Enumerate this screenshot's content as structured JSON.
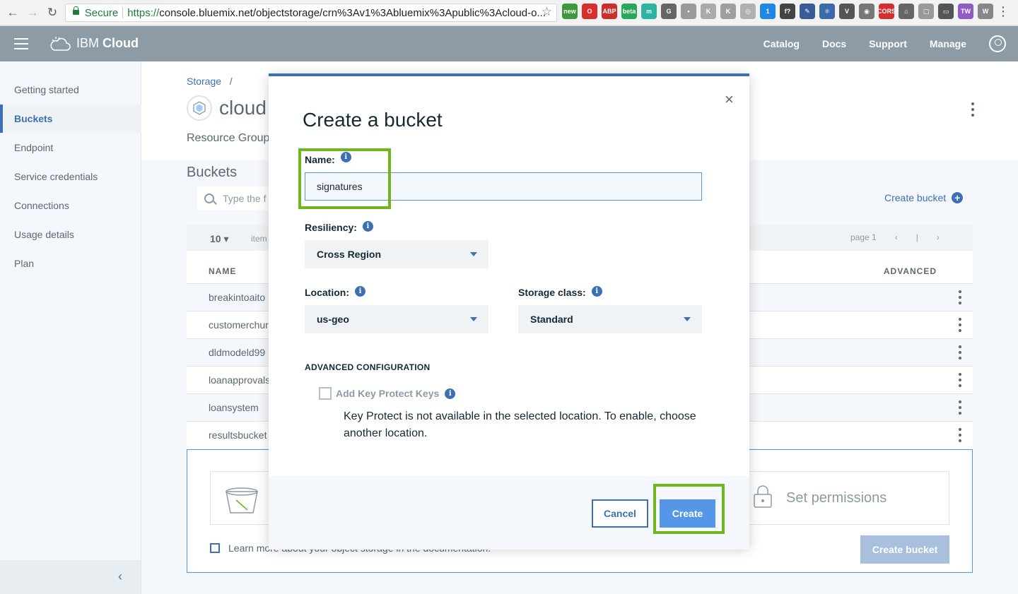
{
  "browser": {
    "secure_label": "Secure",
    "url_scheme": "https://",
    "url_rest": "console.bluemix.net/objectstorage/crn%3Av1%3Abluemix%3Apublic%3Acloud-o...",
    "extensions": [
      {
        "label": "new",
        "color": "#3c9a3c"
      },
      {
        "label": "O",
        "color": "#d82e2e"
      },
      {
        "label": "ABP",
        "color": "#c9302c"
      },
      {
        "label": "beta",
        "color": "#27a85a"
      },
      {
        "label": "m",
        "color": "#2bb5a0"
      },
      {
        "label": "G",
        "color": "#666666"
      },
      {
        "label": "•",
        "color": "#9a9a9a"
      },
      {
        "label": "K",
        "color": "#aaaaaa"
      },
      {
        "label": "K",
        "color": "#9e9e9e"
      },
      {
        "label": "◎",
        "color": "#b0b0b0"
      },
      {
        "label": "1",
        "color": "#1e88e5"
      },
      {
        "label": "f?",
        "color": "#444444"
      },
      {
        "label": "✎",
        "color": "#3a5a9a"
      },
      {
        "label": "⚛",
        "color": "#3b6aa8"
      },
      {
        "label": "V",
        "color": "#555555"
      },
      {
        "label": "◉",
        "color": "#777777"
      },
      {
        "label": "CORS",
        "color": "#d32f2f"
      },
      {
        "label": "⌂",
        "color": "#666666"
      },
      {
        "label": "▢",
        "color": "#999999"
      },
      {
        "label": "▭",
        "color": "#555555"
      },
      {
        "label": "TW",
        "color": "#8e5cc2"
      },
      {
        "label": "W",
        "color": "#888888"
      }
    ]
  },
  "header": {
    "brand_light": "IBM",
    "brand_bold": "Cloud",
    "nav": [
      "Catalog",
      "Docs",
      "Support",
      "Manage"
    ]
  },
  "sidebar": {
    "items": [
      {
        "label": "Getting started",
        "active": false
      },
      {
        "label": "Buckets",
        "active": true
      },
      {
        "label": "Endpoint",
        "active": false
      },
      {
        "label": "Service credentials",
        "active": false
      },
      {
        "label": "Connections",
        "active": false
      },
      {
        "label": "Usage details",
        "active": false
      },
      {
        "label": "Plan",
        "active": false
      }
    ],
    "collapse_glyph": "‹"
  },
  "page": {
    "breadcrumb_link": "Storage",
    "breadcrumb_sep": "/",
    "service_title": "cloud",
    "resource_group": "Resource Group",
    "buckets_title": "Buckets",
    "search_placeholder": "Type the f",
    "create_bucket_link": "Create bucket",
    "per_page": "10",
    "items_label": "item",
    "page_label": "page 1",
    "col_name": "NAME",
    "col_advanced": "ADVANCED",
    "rows": [
      "breakintoaito",
      "customerchur",
      "dldmodeld99",
      "loanapprovals",
      "loansystem",
      "resultsbucket"
    ],
    "set_permissions": "Set permissions",
    "learn_more": "Learn more about your object storage in the documentation.",
    "create_bucket_button": "Create bucket"
  },
  "modal": {
    "title": "Create a bucket",
    "close_glyph": "×",
    "name_label": "Name:",
    "name_value": "signatures",
    "resiliency_label": "Resiliency:",
    "resiliency_value": "Cross Region",
    "location_label": "Location:",
    "location_value": "us-geo",
    "storage_class_label": "Storage class:",
    "storage_class_value": "Standard",
    "advanced_title": "ADVANCED CONFIGURATION",
    "key_protect_label": "Add Key Protect Keys",
    "key_protect_note": "Key Protect is not available in the selected location. To enable, choose another location.",
    "cancel": "Cancel",
    "create": "Create"
  }
}
